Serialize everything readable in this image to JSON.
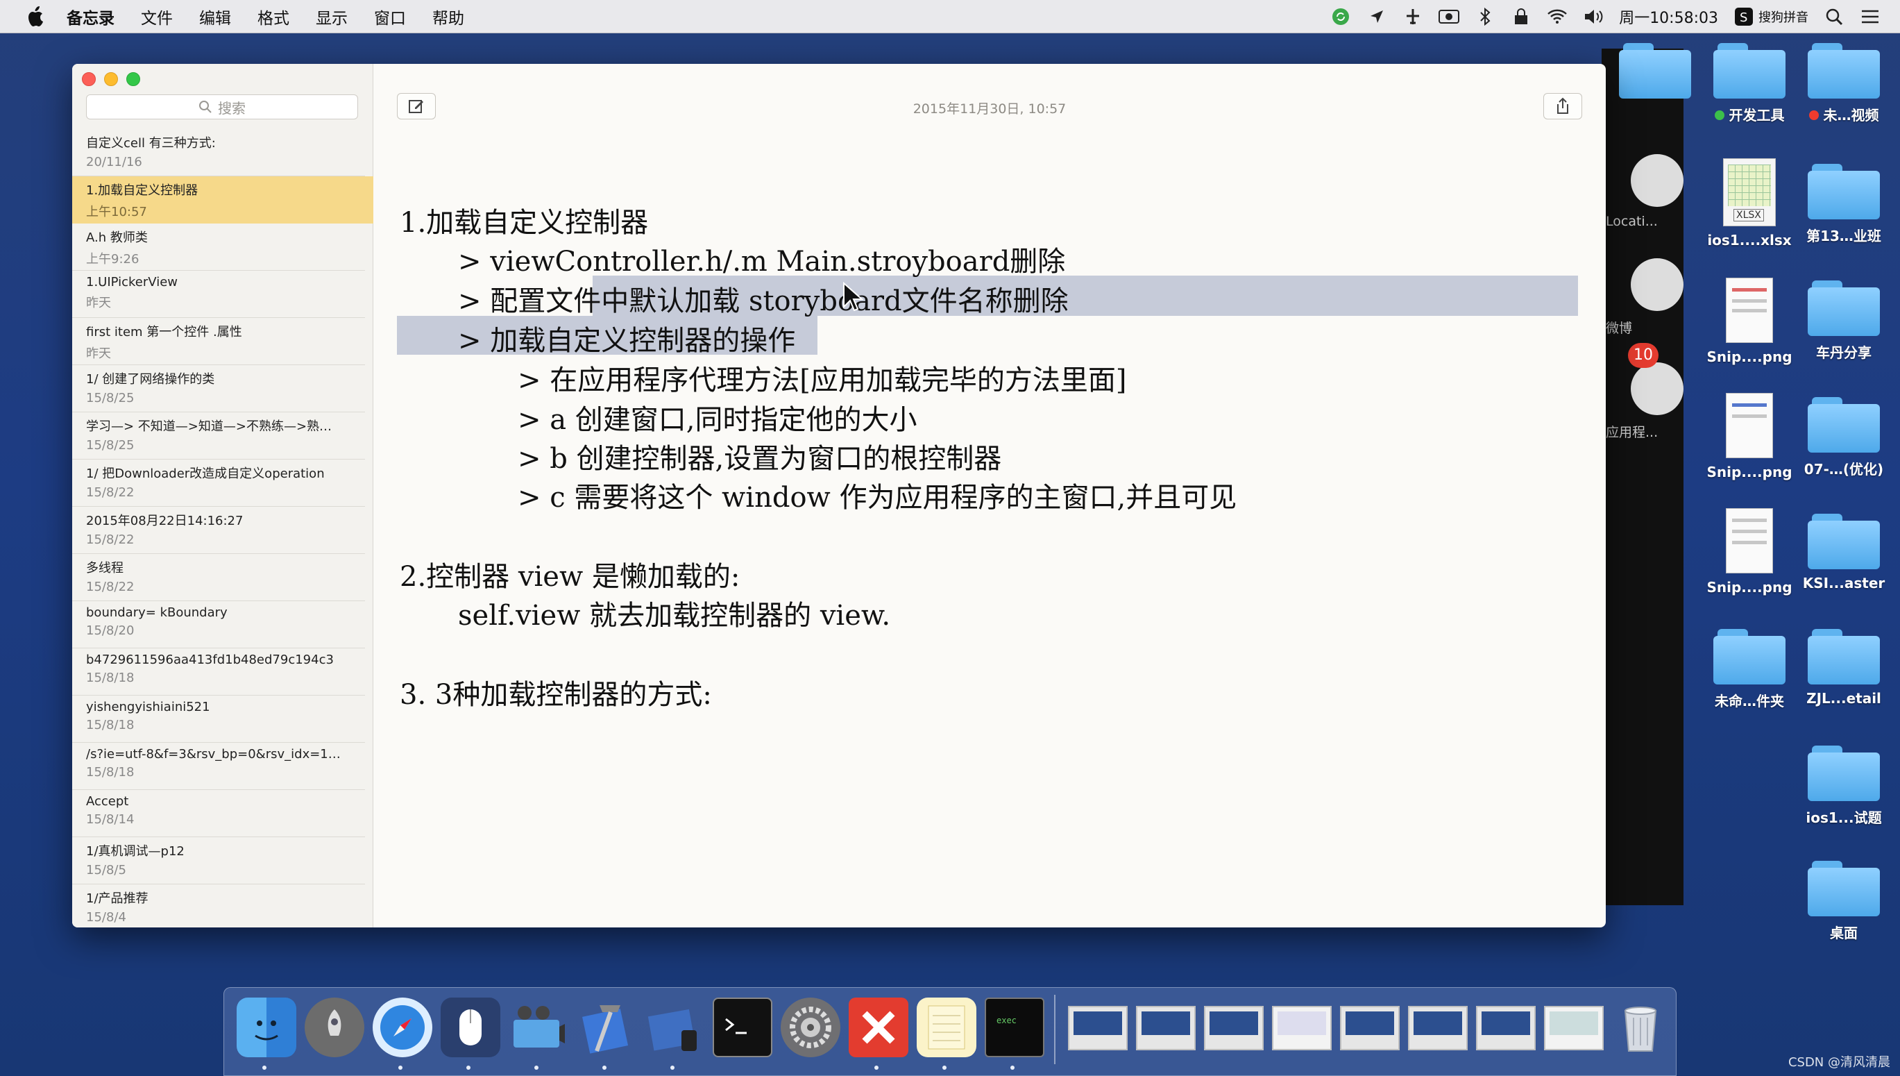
{
  "menubar": {
    "app": "备忘录",
    "items": [
      "文件",
      "编辑",
      "格式",
      "显示",
      "窗口",
      "帮助"
    ],
    "clock": "周一10:58:03",
    "input_method": "搜狗拼音"
  },
  "desktop": {
    "icons": [
      {
        "label": "开发工具",
        "dot": "#3cc04a"
      },
      {
        "label": "未…视频",
        "dot": "#ee3b2f"
      },
      {
        "label": "ios1....xlsx"
      },
      {
        "label": "第13…业班"
      },
      {
        "label": "Snip....png"
      },
      {
        "label": "车丹分享"
      },
      {
        "label": "Snip....png"
      },
      {
        "label": "07-…(优化)"
      },
      {
        "label": "Snip....png"
      },
      {
        "label": "KSI...aster"
      },
      {
        "label": "未命…件夹"
      },
      {
        "label": "ZJL...etail"
      },
      {
        "label": "ios1...试题"
      },
      {
        "label": "桌面"
      }
    ],
    "bg_window_labels": [
      "Locati...",
      "微博",
      "应用程..."
    ],
    "badge_count": "10"
  },
  "notes": {
    "search_placeholder": "搜索",
    "list": [
      {
        "title": "自定义cell 有三种方式:",
        "date": "20/11/16",
        "selected": false
      },
      {
        "title": "1.加载自定义控制器",
        "date": "上午10:57",
        "selected": true
      },
      {
        "title": "A.h  教师类",
        "date": "上午9:26",
        "selected": false
      },
      {
        "title": "1.UIPickerView",
        "date": "昨天",
        "selected": false
      },
      {
        "title": "first item 第一个控件 .属性",
        "date": "昨天",
        "selected": false
      },
      {
        "title": "1/ 创建了网络操作的类",
        "date": "15/8/25",
        "selected": false
      },
      {
        "title": "学习—> 不知道—>知道—>不熟练—>熟…",
        "date": "15/8/25",
        "selected": false
      },
      {
        "title": "1/ 把Downloader改造成自定义operation",
        "date": "15/8/22",
        "selected": false
      },
      {
        "title": "2015年08月22日14:16:27",
        "date": "15/8/22",
        "selected": false
      },
      {
        "title": "多线程",
        "date": "15/8/22",
        "selected": false
      },
      {
        "title": "boundary= kBoundary",
        "date": "15/8/20",
        "selected": false
      },
      {
        "title": "b4729611596aa413fd1b48ed79c194c3",
        "date": "15/8/18",
        "selected": false
      },
      {
        "title": "yishengyishiaini521",
        "date": "15/8/18",
        "selected": false
      },
      {
        "title": "/s?ie=utf-8&f=3&rsv_bp=0&rsv_idx=1…",
        "date": "15/8/18",
        "selected": false
      },
      {
        "title": "Accept",
        "date": "15/8/14",
        "selected": false
      },
      {
        "title": "1/真机调试—p12",
        "date": "15/8/5",
        "selected": false
      },
      {
        "title": "1/产品推荐",
        "date": "15/8/4",
        "selected": false
      }
    ],
    "editor": {
      "timestamp": "2015年11月30日, 10:57",
      "lines": [
        "1.加载自定义控制器",
        ">  viewController.h/.m Main.stroyboard删除",
        ">  配置文件中默认加载 storyboard文件名称删除",
        ">  加载自定义控制器的操作",
        "> 在应用程序代理方法[应用加载完毕的方法里面]",
        "> a 创建窗口,同时指定他的大小",
        "> b 创建控制器,设置为窗口的根控制器",
        "> c 需要将这个 window 作为应用程序的主窗口,并且可见",
        "2.控制器 view 是懒加载的:",
        "self.view 就去加载控制器的 view.",
        "3. 3种加载控制器的方式:"
      ]
    }
  },
  "watermark": "CSDN @清风清晨"
}
